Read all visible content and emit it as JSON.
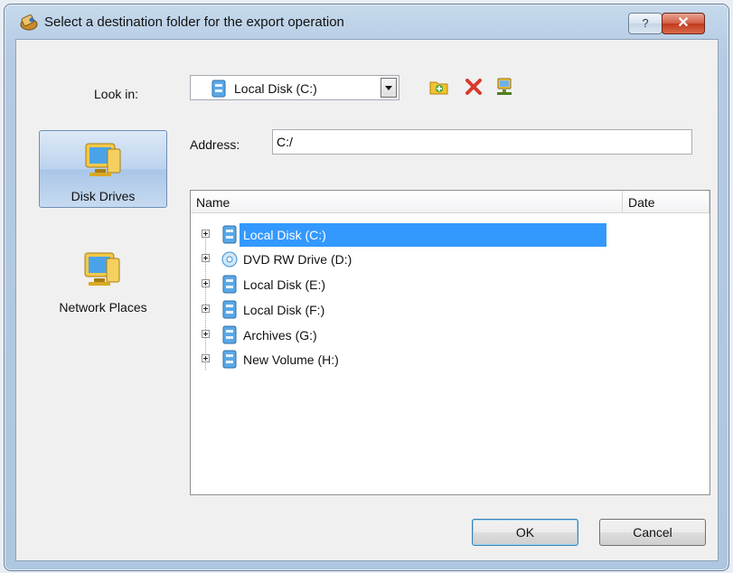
{
  "window": {
    "title": "Select a destination folder for the export operation",
    "help_glyph": "?",
    "close_glyph": "✕",
    "title_icon": "export-icon"
  },
  "toolbar": {
    "look_in_label": "Look in:",
    "look_in_value": "Local Disk (C:)",
    "buttons": [
      "new-folder-icon",
      "delete-icon",
      "network-drive-icon"
    ]
  },
  "sidebar": {
    "items": [
      {
        "label": "Disk Drives",
        "icon": "computer-icon",
        "selected": true
      },
      {
        "label": "Network Places",
        "icon": "network-icon",
        "selected": false
      }
    ]
  },
  "address": {
    "label": "Address:",
    "value": "C:/"
  },
  "list": {
    "columns": [
      "Name",
      "Date"
    ],
    "rows": [
      {
        "label": "Local Disk (C:)",
        "icon": "disk-icon",
        "selected": true
      },
      {
        "label": "DVD RW Drive (D:)",
        "icon": "dvd-icon",
        "selected": false
      },
      {
        "label": "Local Disk (E:)",
        "icon": "disk-icon",
        "selected": false
      },
      {
        "label": "Local Disk (F:)",
        "icon": "disk-icon",
        "selected": false
      },
      {
        "label": "Archives (G:)",
        "icon": "disk-icon",
        "selected": false
      },
      {
        "label": "New Volume (H:)",
        "icon": "disk-icon",
        "selected": false
      }
    ]
  },
  "buttons": {
    "ok": "OK",
    "cancel": "Cancel"
  },
  "colors": {
    "selection": "#3399ff",
    "titlebar": "#b9cfe6",
    "close": "#c2391f"
  }
}
